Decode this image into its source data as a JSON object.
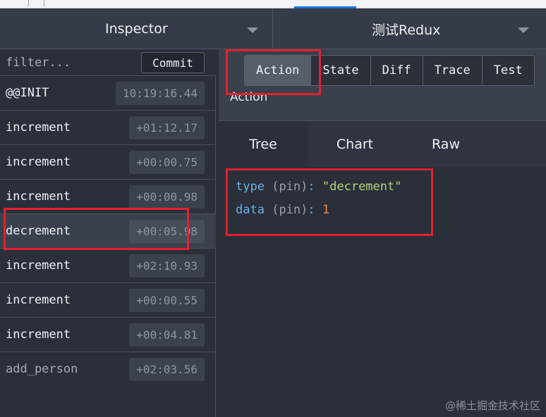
{
  "header": {
    "left_monitor": "Inspector",
    "right_monitor": "测试Redux"
  },
  "actions_panel": {
    "filter_placeholder": "filter...",
    "commit_label": "Commit",
    "rows": [
      {
        "name": "@@INIT",
        "time": "10:19:16.44"
      },
      {
        "name": "increment",
        "time": "+01:12.17"
      },
      {
        "name": "increment",
        "time": "+00:00.75"
      },
      {
        "name": "increment",
        "time": "+00:00.98"
      },
      {
        "name": "decrement",
        "time": "+00:05.98"
      },
      {
        "name": "increment",
        "time": "+02:10.93"
      },
      {
        "name": "increment",
        "time": "+00:00.55"
      },
      {
        "name": "increment",
        "time": "+00:04.81"
      },
      {
        "name": "add_person",
        "time": "+02:03.56"
      }
    ]
  },
  "detail": {
    "tabs": [
      "Action",
      "State",
      "Diff",
      "Trace",
      "Test"
    ],
    "heading": "Action",
    "subtabs": [
      "Tree",
      "Chart",
      "Raw"
    ],
    "tree": [
      {
        "key": "type",
        "pin": "(pin)",
        "value": "\"decrement\""
      },
      {
        "key": "data",
        "pin": "(pin)",
        "value": "1"
      }
    ]
  },
  "watermark": "@稀土掘金技术社区"
}
